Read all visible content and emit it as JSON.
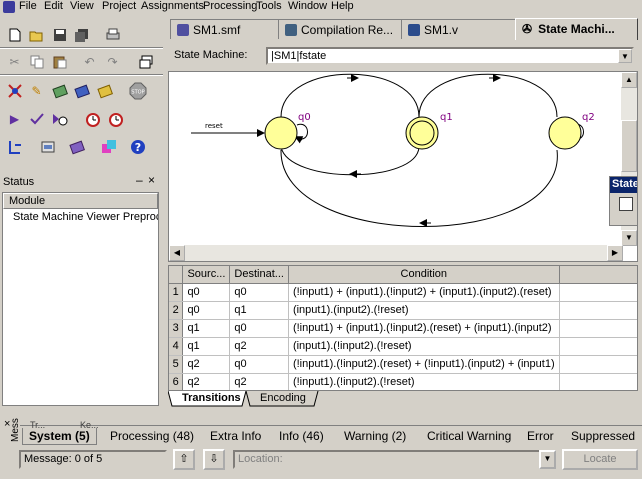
{
  "menu": [
    "File",
    "Edit",
    "View",
    "Project",
    "Assignments",
    "Processing",
    "Tools",
    "Window",
    "Help"
  ],
  "doc_tabs": [
    {
      "label": "SM1.smf",
      "icon": "smf-file-icon",
      "color": "#5050a0"
    },
    {
      "label": "Compilation Re...",
      "icon": "report-icon",
      "color": "#406080"
    },
    {
      "label": "SM1.v",
      "icon": "verilog-file-icon",
      "color": "#2c4c8c"
    },
    {
      "label": "State Machi...",
      "icon": "state-machine-icon",
      "color": "#303030"
    }
  ],
  "state_machine": {
    "label": "State Machine:",
    "value": "|SM1|fstate"
  },
  "diagram": {
    "states": [
      {
        "name": "q0",
        "initial": true,
        "fill": "#ffff99"
      },
      {
        "name": "q1",
        "initial": false,
        "fill": "#ffff99"
      },
      {
        "name": "q2",
        "initial": false,
        "fill": "#ffff99"
      }
    ],
    "reset_label": "reset",
    "state_label_color": "#800080"
  },
  "side_panel": {
    "label": "State"
  },
  "status": {
    "title": "Status",
    "column": "Module",
    "rows": [
      "State Machine Viewer Preproc"
    ]
  },
  "transitions": {
    "columns": [
      "Sourc...",
      "Destinat...",
      "Condition"
    ],
    "rows": [
      {
        "n": "1",
        "src": "q0",
        "dst": "q0",
        "cond": "(!input1) + (input1).(!input2) + (input1).(input2).(reset)"
      },
      {
        "n": "2",
        "src": "q0",
        "dst": "q1",
        "cond": "(input1).(input2).(!reset)"
      },
      {
        "n": "3",
        "src": "q1",
        "dst": "q0",
        "cond": "(!input1) + (input1).(!input2).(reset) + (input1).(input2)"
      },
      {
        "n": "4",
        "src": "q1",
        "dst": "q2",
        "cond": "(input1).(!input2).(!reset)"
      },
      {
        "n": "5",
        "src": "q2",
        "dst": "q0",
        "cond": "(!input1).(!input2).(reset) + (!input1).(input2) + (input1)"
      },
      {
        "n": "6",
        "src": "q2",
        "dst": "q2",
        "cond": "(!input1).(!input2).(!reset)"
      }
    ]
  },
  "bottom_tabs": [
    "Transitions",
    "Encoding"
  ],
  "messages": {
    "side_label": "Mess",
    "tabs": [
      "System (5)",
      "Processing (48)",
      "Extra Info",
      "Info (46)",
      "Warning (2)",
      "Critical Warning",
      "Error",
      "Suppressed"
    ],
    "hidden_tabs": [
      "Tr...",
      "Ke..."
    ],
    "counter": "Message: 0 of 5",
    "location_placeholder": "Location:",
    "locate": "Locate"
  }
}
